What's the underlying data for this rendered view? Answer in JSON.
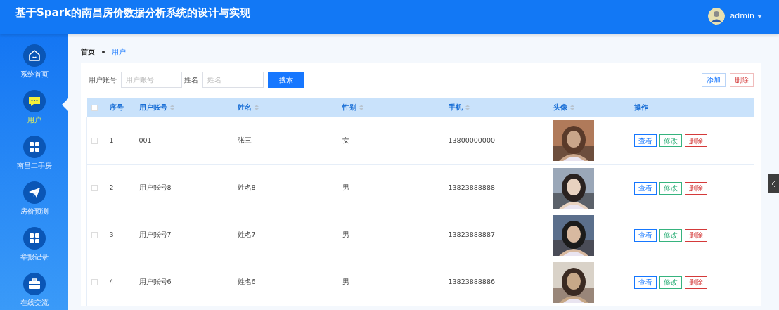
{
  "header": {
    "title": "基于Spark的南昌房价数据分析系统的设计与实现",
    "user": {
      "name": "admin"
    }
  },
  "sidebar": {
    "items": [
      {
        "label": "系统首页",
        "selected": false
      },
      {
        "label": "用户",
        "selected": true
      },
      {
        "label": "南昌二手房",
        "selected": false
      },
      {
        "label": "房价预测",
        "selected": false
      },
      {
        "label": "举报记录",
        "selected": false
      },
      {
        "label": "在线交流",
        "selected": false
      }
    ]
  },
  "breadcrumb": [
    "首页",
    "用户"
  ],
  "search": {
    "fields": [
      {
        "label": "用户账号",
        "placeholder": "用户账号"
      },
      {
        "label": "姓名",
        "placeholder": "姓名"
      }
    ],
    "button": "搜索"
  },
  "toolbar": [
    {
      "label": "添加",
      "kind": "add"
    },
    {
      "label": "删除",
      "kind": "delete"
    }
  ],
  "table": {
    "select_all": {
      "checked": false
    },
    "columns": [
      {
        "label": "序号",
        "sortable": false
      },
      {
        "label": "用户账号",
        "sortable": true
      },
      {
        "label": "姓名",
        "sortable": true
      },
      {
        "label": "性别",
        "sortable": true
      },
      {
        "label": "手机",
        "sortable": true
      },
      {
        "label": "头像",
        "sortable": true
      },
      {
        "label": "操作",
        "sortable": false
      }
    ],
    "rows": [
      {
        "checked": false,
        "cells": [
          "1",
          "001",
          "张三",
          "女",
          "13800000000"
        ],
        "avatar": {
          "kind": "picture"
        },
        "actions": [
          {
            "label": "查看",
            "kind": "view"
          },
          {
            "label": "修改",
            "kind": "edit"
          },
          {
            "label": "删除",
            "kind": "delete"
          }
        ]
      },
      {
        "checked": false,
        "cells": [
          "2",
          "用户账号8",
          "姓名8",
          "男",
          "13823888888"
        ],
        "avatar": {
          "kind": "picture"
        },
        "actions": [
          {
            "label": "查看",
            "kind": "view"
          },
          {
            "label": "修改",
            "kind": "edit"
          },
          {
            "label": "删除",
            "kind": "delete"
          }
        ]
      },
      {
        "checked": false,
        "cells": [
          "3",
          "用户账号7",
          "姓名7",
          "男",
          "13823888887"
        ],
        "avatar": {
          "kind": "picture"
        },
        "actions": [
          {
            "label": "查看",
            "kind": "view"
          },
          {
            "label": "修改",
            "kind": "edit"
          },
          {
            "label": "删除",
            "kind": "delete"
          }
        ]
      },
      {
        "checked": false,
        "cells": [
          "4",
          "用户账号6",
          "姓名6",
          "男",
          "13823888886"
        ],
        "avatar": {
          "kind": "picture"
        },
        "actions": [
          {
            "label": "查看",
            "kind": "view"
          },
          {
            "label": "修改",
            "kind": "edit"
          },
          {
            "label": "删除",
            "kind": "delete"
          }
        ]
      }
    ]
  }
}
